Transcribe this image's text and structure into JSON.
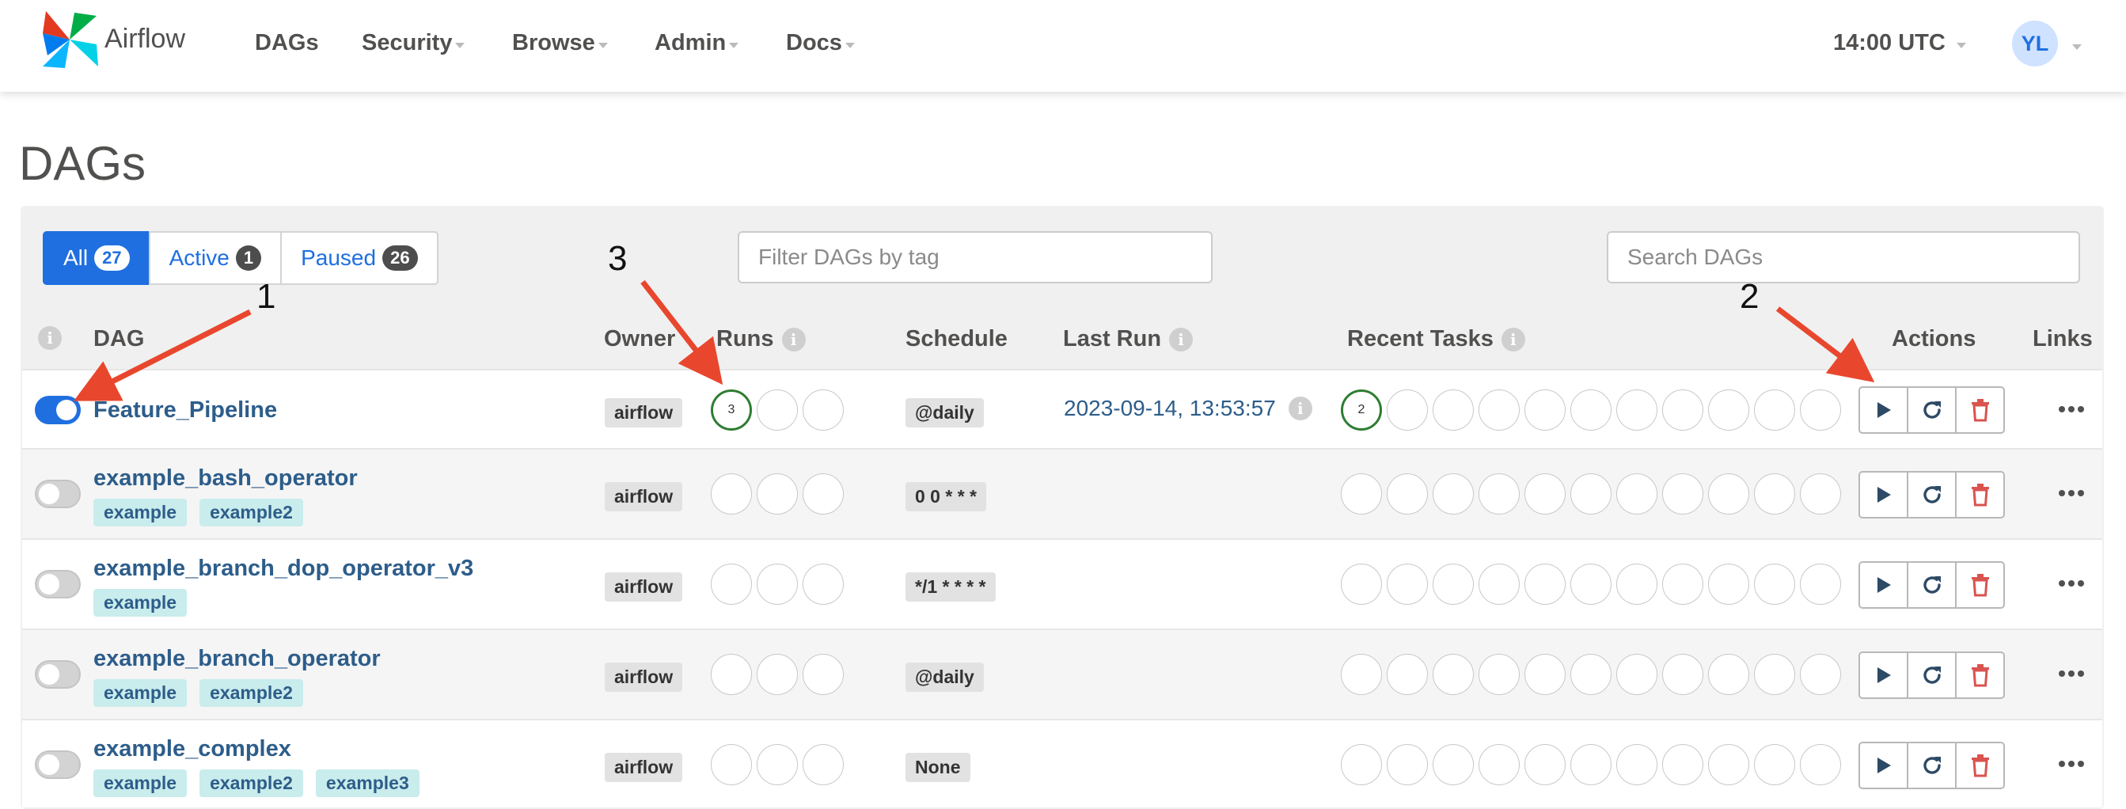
{
  "nav": {
    "brand": "Airflow",
    "items": [
      {
        "label": "DAGs",
        "dropdown": false
      },
      {
        "label": "Security",
        "dropdown": true
      },
      {
        "label": "Browse",
        "dropdown": true
      },
      {
        "label": "Admin",
        "dropdown": true
      },
      {
        "label": "Docs",
        "dropdown": true
      }
    ],
    "clock": "14:00 UTC",
    "user_initials": "YL"
  },
  "page": {
    "title": "DAGs"
  },
  "filters": [
    {
      "label": "All",
      "count": "27",
      "active": true
    },
    {
      "label": "Active",
      "count": "1",
      "active": false
    },
    {
      "label": "Paused",
      "count": "26",
      "active": false
    }
  ],
  "tag_filter": {
    "placeholder": "Filter DAGs by tag"
  },
  "search": {
    "placeholder": "Search DAGs"
  },
  "columns": {
    "info": "i",
    "dag": "DAG",
    "owner": "Owner",
    "runs": "Runs",
    "schedule": "Schedule",
    "last_run": "Last Run",
    "recent_tasks": "Recent Tasks",
    "actions": "Actions",
    "links": "Links"
  },
  "rows": [
    {
      "name": "Feature_Pipeline",
      "enabled": true,
      "tags": [],
      "owner": "airflow",
      "schedule": "@daily",
      "last_run": "2023-09-14, 13:53:57",
      "runs_success_count": "3",
      "recent_tasks_success_count": "2"
    },
    {
      "name": "example_bash_operator",
      "enabled": false,
      "tags": [
        "example",
        "example2"
      ],
      "owner": "airflow",
      "schedule": "0 0 * * *",
      "last_run": "",
      "runs_success_count": "",
      "recent_tasks_success_count": ""
    },
    {
      "name": "example_branch_dop_operator_v3",
      "enabled": false,
      "tags": [
        "example"
      ],
      "owner": "airflow",
      "schedule": "*/1 * * * *",
      "last_run": "",
      "runs_success_count": "",
      "recent_tasks_success_count": ""
    },
    {
      "name": "example_branch_operator",
      "enabled": false,
      "tags": [
        "example",
        "example2"
      ],
      "owner": "airflow",
      "schedule": "@daily",
      "last_run": "",
      "runs_success_count": "",
      "recent_tasks_success_count": ""
    },
    {
      "name": "example_complex",
      "enabled": false,
      "tags": [
        "example",
        "example2",
        "example3"
      ],
      "owner": "airflow",
      "schedule": "None",
      "last_run": "",
      "runs_success_count": "",
      "recent_tasks_success_count": ""
    }
  ],
  "action_icons": [
    "play-icon",
    "refresh-icon",
    "trash-icon"
  ],
  "links_icon": "more-horizontal-icon",
  "annotations": [
    "1",
    "2",
    "3"
  ],
  "colors": {
    "primary": "#1f6fe0",
    "success": "#2e7d32",
    "danger": "#d9534f",
    "link": "#2d5d8a",
    "tag": "#c9ecec",
    "annotation_arrow": "#e8472e"
  }
}
